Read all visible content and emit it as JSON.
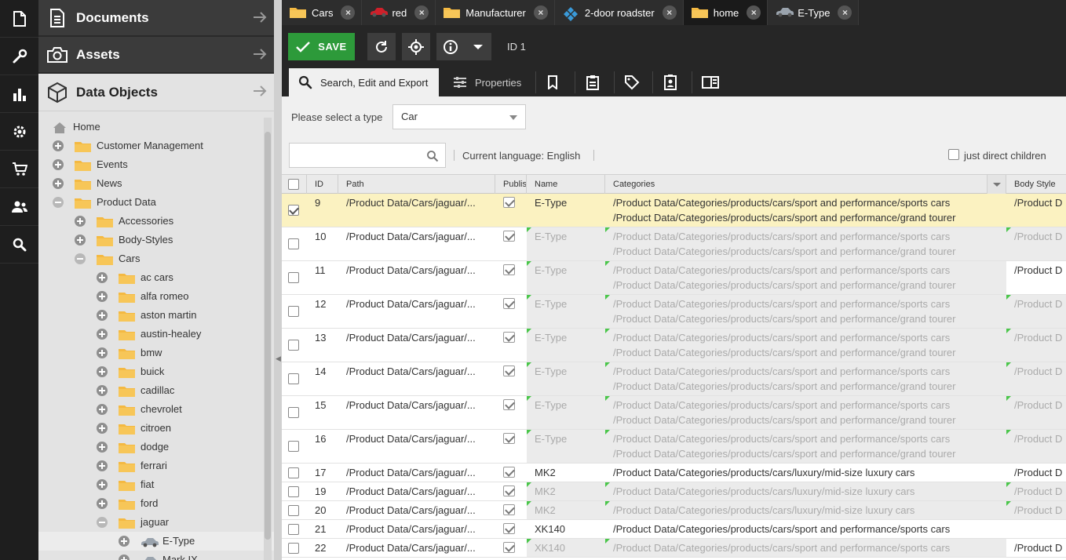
{
  "rail": {
    "items": [
      "document-icon",
      "wrench-icon",
      "bar-chart-icon",
      "gear-icon",
      "cart-icon",
      "users-icon",
      "search-icon"
    ]
  },
  "tree": {
    "sections": [
      {
        "name": "documents",
        "label": "Documents"
      },
      {
        "name": "assets",
        "label": "Assets"
      },
      {
        "name": "data-objects",
        "label": "Data Objects"
      }
    ],
    "nodes": [
      {
        "label": "Home",
        "level": 0,
        "expander": "none",
        "icon": "home"
      },
      {
        "label": "Customer Management",
        "level": 0,
        "expander": "plus",
        "icon": "folder"
      },
      {
        "label": "Events",
        "level": 0,
        "expander": "plus",
        "icon": "folder"
      },
      {
        "label": "News",
        "level": 0,
        "expander": "plus",
        "icon": "folder"
      },
      {
        "label": "Product Data",
        "level": 0,
        "expander": "minus",
        "icon": "folder"
      },
      {
        "label": "Accessories",
        "level": 1,
        "expander": "plus",
        "icon": "folder"
      },
      {
        "label": "Body-Styles",
        "level": 1,
        "expander": "plus",
        "icon": "folder"
      },
      {
        "label": "Cars",
        "level": 1,
        "expander": "minus",
        "icon": "folder"
      },
      {
        "label": "ac cars",
        "level": 2,
        "expander": "plus",
        "icon": "folder"
      },
      {
        "label": "alfa romeo",
        "level": 2,
        "expander": "plus",
        "icon": "folder"
      },
      {
        "label": "aston martin",
        "level": 2,
        "expander": "plus",
        "icon": "folder"
      },
      {
        "label": "austin-healey",
        "level": 2,
        "expander": "plus",
        "icon": "folder"
      },
      {
        "label": "bmw",
        "level": 2,
        "expander": "plus",
        "icon": "folder"
      },
      {
        "label": "buick",
        "level": 2,
        "expander": "plus",
        "icon": "folder"
      },
      {
        "label": "cadillac",
        "level": 2,
        "expander": "plus",
        "icon": "folder"
      },
      {
        "label": "chevrolet",
        "level": 2,
        "expander": "plus",
        "icon": "folder"
      },
      {
        "label": "citroen",
        "level": 2,
        "expander": "plus",
        "icon": "folder"
      },
      {
        "label": "dodge",
        "level": 2,
        "expander": "plus",
        "icon": "folder"
      },
      {
        "label": "ferrari",
        "level": 2,
        "expander": "plus",
        "icon": "folder"
      },
      {
        "label": "fiat",
        "level": 2,
        "expander": "plus",
        "icon": "folder"
      },
      {
        "label": "ford",
        "level": 2,
        "expander": "plus",
        "icon": "folder"
      },
      {
        "label": "jaguar",
        "level": 2,
        "expander": "minus",
        "icon": "folder"
      },
      {
        "label": "E-Type",
        "level": 3,
        "expander": "plus",
        "icon": "car",
        "selected": true
      },
      {
        "label": "Mark IX",
        "level": 3,
        "expander": "plus",
        "icon": "car"
      }
    ]
  },
  "tabs": [
    {
      "label": "Cars",
      "icon": "folder",
      "active": false
    },
    {
      "label": "red",
      "icon": "red-car",
      "active": false
    },
    {
      "label": "Manufacturer",
      "icon": "folder",
      "active": false
    },
    {
      "label": "2-door roadster",
      "icon": "diamond",
      "active": false
    },
    {
      "label": "home",
      "icon": "folder",
      "active": true
    },
    {
      "label": "E-Type",
      "icon": "car",
      "active": false
    }
  ],
  "toolbar": {
    "save_label": "SAVE",
    "id_label": "ID 1"
  },
  "subtabs": [
    {
      "label": "Search, Edit and Export",
      "icon": "search-icon",
      "active": true
    },
    {
      "label": "Properties",
      "icon": "sliders-icon",
      "active": false
    },
    {
      "label": "",
      "icon": "bookmark-icon"
    },
    {
      "label": "",
      "icon": "clipboard-icon"
    },
    {
      "label": "",
      "icon": "tag-icon"
    },
    {
      "label": "",
      "icon": "id-badge-icon"
    },
    {
      "label": "",
      "icon": "panel-icon"
    }
  ],
  "type_filter": {
    "label": "Please select a type",
    "value": "Car"
  },
  "search": {
    "placeholder": "",
    "language_label": "Current language: English",
    "direct_children_label": "just direct children"
  },
  "grid": {
    "columns": [
      "ID",
      "Path",
      "Published",
      "Name",
      "Categories",
      "Body Style"
    ],
    "rows": [
      {
        "id": "9",
        "path": "/Product Data/Cars/jaguar/...",
        "name": "E-Type",
        "categories": [
          "/Product Data/Categories/products/cars/sport and performance/sports cars",
          "/Product Data/Categories/products/cars/sport and performance/grand tourer"
        ],
        "body": "/Product D",
        "selected": true,
        "inherited": false,
        "body_inherited": false,
        "body_dim": false
      },
      {
        "id": "10",
        "path": "/Product Data/Cars/jaguar/...",
        "name": "E-Type",
        "categories": [
          "/Product Data/Categories/products/cars/sport and performance/sports cars",
          "/Product Data/Categories/products/cars/sport and performance/grand tourer"
        ],
        "body": "/Product D",
        "inherited": true,
        "body_inherited": true
      },
      {
        "id": "11",
        "path": "/Product Data/Cars/jaguar/...",
        "name": "E-Type",
        "categories": [
          "/Product Data/Categories/products/cars/sport and performance/sports cars",
          "/Product Data/Categories/products/cars/sport and performance/grand tourer"
        ],
        "body": "/Product D",
        "inherited": true,
        "body_inherited": false
      },
      {
        "id": "12",
        "path": "/Product Data/Cars/jaguar/...",
        "name": "E-Type",
        "categories": [
          "/Product Data/Categories/products/cars/sport and performance/sports cars",
          "/Product Data/Categories/products/cars/sport and performance/grand tourer"
        ],
        "body": "/Product D",
        "inherited": true,
        "body_inherited": true
      },
      {
        "id": "13",
        "path": "/Product Data/Cars/jaguar/...",
        "name": "E-Type",
        "categories": [
          "/Product Data/Categories/products/cars/sport and performance/sports cars",
          "/Product Data/Categories/products/cars/sport and performance/grand tourer"
        ],
        "body": "/Product D",
        "inherited": true,
        "body_inherited": true
      },
      {
        "id": "14",
        "path": "/Product Data/Cars/jaguar/...",
        "name": "E-Type",
        "categories": [
          "/Product Data/Categories/products/cars/sport and performance/sports cars",
          "/Product Data/Categories/products/cars/sport and performance/grand tourer"
        ],
        "body": "/Product D",
        "inherited": true,
        "body_inherited": true
      },
      {
        "id": "15",
        "path": "/Product Data/Cars/jaguar/...",
        "name": "E-Type",
        "categories": [
          "/Product Data/Categories/products/cars/sport and performance/sports cars",
          "/Product Data/Categories/products/cars/sport and performance/grand tourer"
        ],
        "body": "/Product D",
        "inherited": true,
        "body_inherited": true
      },
      {
        "id": "16",
        "path": "/Product Data/Cars/jaguar/...",
        "name": "E-Type",
        "categories": [
          "/Product Data/Categories/products/cars/sport and performance/sports cars",
          "/Product Data/Categories/products/cars/sport and performance/grand tourer"
        ],
        "body": "/Product D",
        "inherited": true,
        "body_inherited": true
      },
      {
        "id": "17",
        "path": "/Product Data/Cars/jaguar/...",
        "name": "MK2",
        "categories": [
          "/Product Data/Categories/products/cars/luxury/mid-size luxury cars"
        ],
        "body": "/Product D",
        "inherited": false,
        "body_inherited": false
      },
      {
        "id": "19",
        "path": "/Product Data/Cars/jaguar/...",
        "name": "MK2",
        "categories": [
          "/Product Data/Categories/products/cars/luxury/mid-size luxury cars"
        ],
        "body": "/Product D",
        "inherited": true,
        "body_inherited": true
      },
      {
        "id": "20",
        "path": "/Product Data/Cars/jaguar/...",
        "name": "MK2",
        "categories": [
          "/Product Data/Categories/products/cars/luxury/mid-size luxury cars"
        ],
        "body": "/Product D",
        "inherited": true,
        "body_inherited": true
      },
      {
        "id": "21",
        "path": "/Product Data/Cars/jaguar/...",
        "name": "XK140",
        "categories": [
          "/Product Data/Categories/products/cars/sport and performance/sports cars"
        ],
        "body": "",
        "inherited": false,
        "body_inherited": false
      },
      {
        "id": "22",
        "path": "/Product Data/Cars/jaguar/...",
        "name": "XK140",
        "categories": [
          "/Product Data/Categories/products/cars/sport and performance/sports cars"
        ],
        "body": "/Product D",
        "inherited": true,
        "body_inherited": false
      }
    ]
  },
  "colors": {
    "save_green": "#2d9a3a",
    "selected_row": "#fbf2c1",
    "folder": "#f4b942",
    "dark_bg": "#262626",
    "inherit_marker": "#4ac64a"
  }
}
